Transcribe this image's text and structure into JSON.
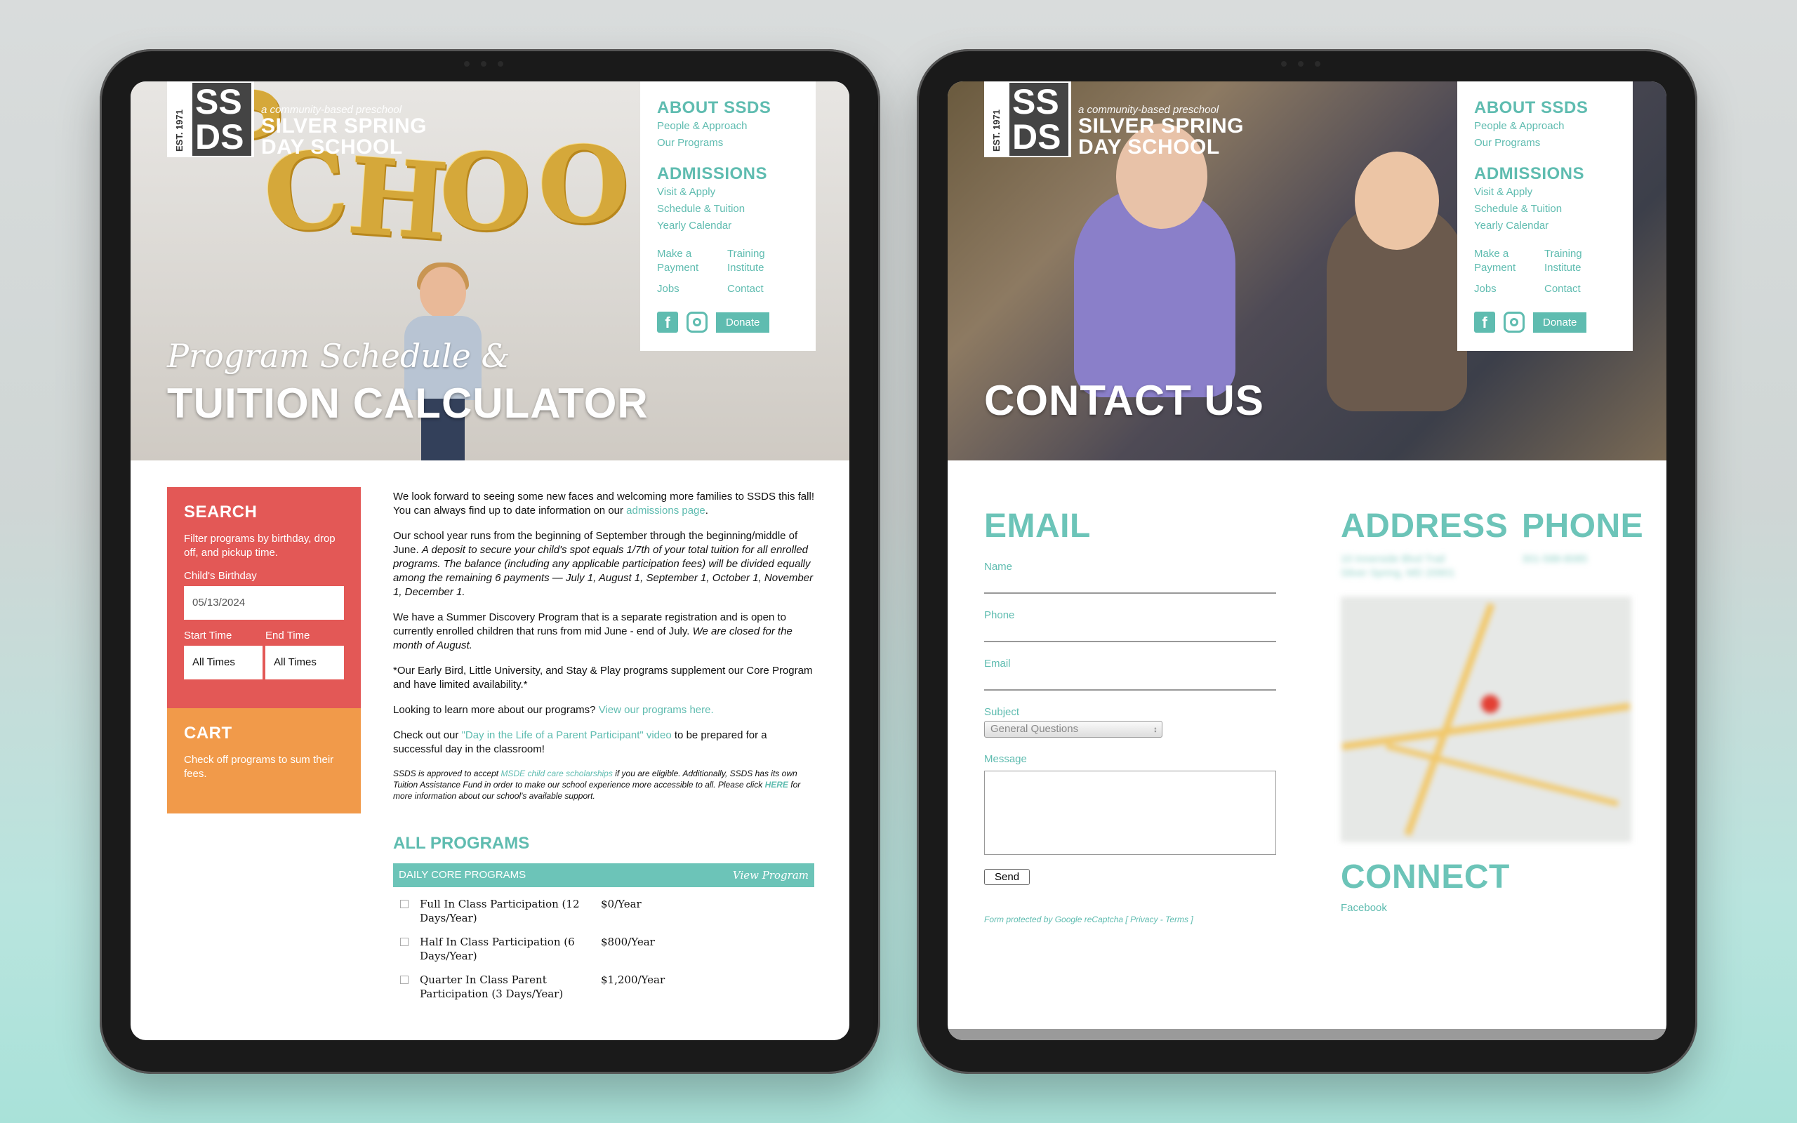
{
  "brand": {
    "est": "EST. 1971",
    "letters_top": "SS",
    "letters_bottom": "DS",
    "tagline": "a community-based preschool",
    "name_line1": "SILVER SPRING",
    "name_line2": "DAY SCHOOL"
  },
  "nav": {
    "about_heading": "ABOUT SSDS",
    "about_items": [
      "People & Approach",
      "Our Programs"
    ],
    "admissions_heading": "ADMISSIONS",
    "admissions_items": [
      "Visit & Apply",
      "Schedule & Tuition",
      "Yearly Calendar"
    ],
    "extra_items": [
      "Make a Payment",
      "Training Institute",
      "Jobs",
      "Contact"
    ],
    "donate": "Donate",
    "social_icons": [
      "facebook-icon",
      "instagram-icon"
    ]
  },
  "left_page": {
    "balloon_letters": "SCHOO",
    "hero_subtitle": "Program Schedule &",
    "hero_title": "TUITION CALCULATOR",
    "search": {
      "heading": "SEARCH",
      "description": "Filter programs by birthday, drop off, and pickup time.",
      "birthday_label": "Child's Birthday",
      "birthday_value": "05/13/2024",
      "start_label": "Start Time",
      "start_value": "All Times",
      "end_label": "End Time",
      "end_value": "All Times"
    },
    "cart": {
      "heading": "CART",
      "description": "Check off programs to sum their fees."
    },
    "body": {
      "p1_text": "We look forward to seeing some new faces and welcoming more families to SSDS this fall! You can always find up to date information on our",
      "p1_link": "admissions page",
      "p2_text": "Our school year runs from the beginning of September through the beginning/middle of June.",
      "p2_italic": "A deposit to secure your child's spot equals 1/7th of your total tuition for all enrolled programs. The balance (including any applicable participation fees) will be divided equally among the remaining 6 payments — July 1, August 1, September 1, October 1, November 1, December 1.",
      "p3_text": "We have a Summer Discovery Program that is a separate registration and is open to currently enrolled children that runs from mid June - end of July.",
      "p3_italic": "We are closed for the month of August.",
      "p4_text": "*Our Early Bird, Little University, and Stay & Play programs supplement our Core Program and have limited availability.*",
      "p5_text": "Looking to learn more about our programs?",
      "p5_link": "View our programs here.",
      "p6_text1": "Check out our",
      "p6_link": "\"Day in the Life of a Parent Participant\" video",
      "p6_text2": "to be prepared for a successful day in the classroom!",
      "small1": "SSDS is approved to accept",
      "small_link1": "MSDE child care scholarships",
      "small2": "if you are eligible. Additionally, SSDS has its own Tuition Assistance Fund in order to make our school experience more accessible to all. Please click",
      "small_link2": "HERE",
      "small3": "for more information about our school's available support."
    },
    "all_programs": "ALL PROGRAMS",
    "table_head": "DAILY CORE PROGRAMS",
    "table_link": "View Program",
    "programs": [
      {
        "name": "Full In Class Participation (12 Days/Year)",
        "price": "$0/Year"
      },
      {
        "name": "Half In Class Participation (6 Days/Year)",
        "price": "$800/Year"
      },
      {
        "name": "Quarter In Class Parent Participation (3 Days/Year)",
        "price": "$1,200/Year"
      }
    ]
  },
  "right_page": {
    "hero_title": "CONTACT US",
    "email_heading": "EMAIL",
    "fields": {
      "name": "Name",
      "phone": "Phone",
      "email": "Email",
      "subject": "Subject",
      "subject_value": "General Questions",
      "message": "Message"
    },
    "send": "Send",
    "recaptcha": "Form protected by Google reCaptcha [ Privacy - Terms ]",
    "address_heading": "ADDRESS",
    "address_lines": [
      "10 Innerside Blvd Trail",
      "Silver Spring, MD 20901"
    ],
    "phone_heading": "PHONE",
    "phone_value": "301-588-8085",
    "connect_heading": "CONNECT",
    "facebook": "Facebook"
  },
  "colors": {
    "teal": "#6cc4b8",
    "search_red": "#e35856",
    "cart_orange": "#f19a4a"
  }
}
